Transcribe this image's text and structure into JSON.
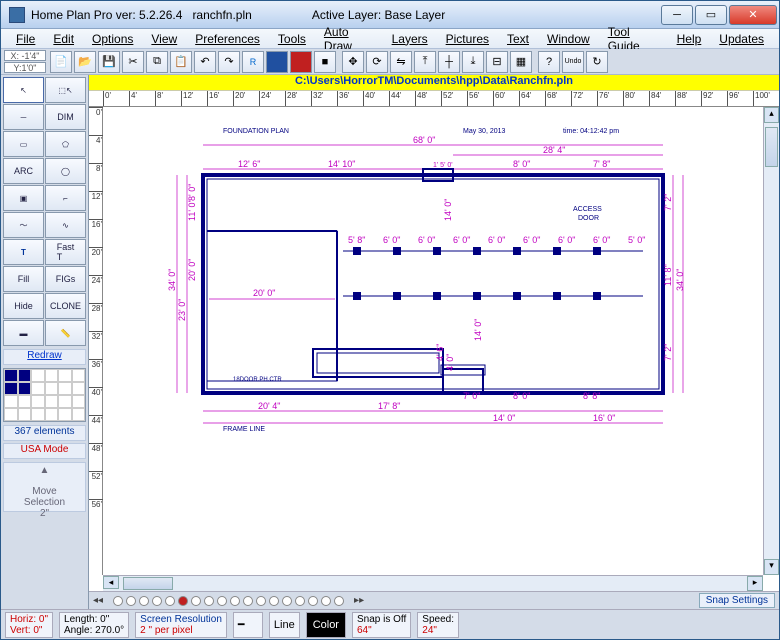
{
  "title": {
    "app": "Home Plan Pro ver: 5.2.26.4",
    "file": "ranchfn.pln",
    "layer": "Active Layer: Base Layer"
  },
  "menu": [
    "File",
    "Edit",
    "Options",
    "View",
    "Preferences",
    "Tools",
    "Auto Draw",
    "Layers",
    "Pictures",
    "Text",
    "Window",
    "Tool Guide",
    "Help",
    "Updates"
  ],
  "coord": {
    "x": "X: -1'4\"",
    "y": "Y:1'0\""
  },
  "pathbar": "C:\\Users\\HorrorTM\\Documents\\hpp\\Data\\Ranchfn.pln",
  "ruler_h": [
    "0'",
    "4'",
    "8'",
    "12'",
    "16'",
    "20'",
    "24'",
    "28'",
    "32'",
    "36'",
    "40'",
    "44'",
    "48'",
    "52'",
    "56'",
    "60'",
    "64'",
    "68'",
    "72'",
    "76'",
    "80'",
    "84'",
    "88'",
    "92'",
    "96'",
    "100'"
  ],
  "ruler_v": [
    "0'",
    "4'",
    "8'",
    "12'",
    "16'",
    "20'",
    "24'",
    "28'",
    "32'",
    "36'",
    "40'",
    "44'",
    "48'",
    "52'",
    "56'"
  ],
  "sidebar": {
    "redraw": "Redraw",
    "elements": "367 elements",
    "mode": "USA Mode",
    "move": "Move\nSelection\n2\""
  },
  "plan_labels": {
    "title": "FOUNDATION PLAN",
    "date": "May 30, 2013",
    "time": "time: 04:12:42 pm",
    "access": "ACCESS\nDOOR",
    "door_note": "18DOOR.PH.CTR",
    "frame": "FRAME LINE"
  },
  "dimensions": {
    "overall_w": "68' 0\"",
    "right_span": "28' 4\"",
    "top": [
      "12' 6\"",
      "14' 10\"",
      "1' 5' 0'",
      "8' 0\"",
      "7' 8\""
    ],
    "left_v": [
      "8' 0\"",
      "11' 0\"",
      "20' 0\"",
      "23' 0\"",
      "34' 0\""
    ],
    "joist_row": [
      "5' 8\"",
      "6' 0\"",
      "6' 0\"",
      "6' 0\"",
      "6' 0\"",
      "6' 0\"",
      "6' 0\"",
      "6' 0\"",
      "5' 0\""
    ],
    "garage_w": "20' 0\"",
    "mid_v": [
      "14' 0\"",
      "14' 0\"",
      "4' 0\"",
      "4' 6\""
    ],
    "right_v": [
      "7' 2\"",
      "11' 8\"",
      "7' 2\"",
      "34' 0\""
    ],
    "bottom": [
      "20' 4\"",
      "17' 8\"",
      "7' 0\"",
      "8' 0\"",
      "8' 8\"",
      "14' 0\"",
      "16' 0\""
    ]
  },
  "snap": {
    "label": "Snap Settings"
  },
  "status": {
    "horiz": "Horiz: 0\"",
    "vert": "Vert:  0\"",
    "length": "Length:  0\"",
    "angle": "Angle: 270.0°",
    "res1": "Screen Resolution",
    "res2": "2 \" per pixel",
    "line": "Line",
    "color": "Color",
    "snap1": "Snap is Off",
    "snap2": "64\"",
    "speed1": "Speed:",
    "speed2": "24\""
  }
}
